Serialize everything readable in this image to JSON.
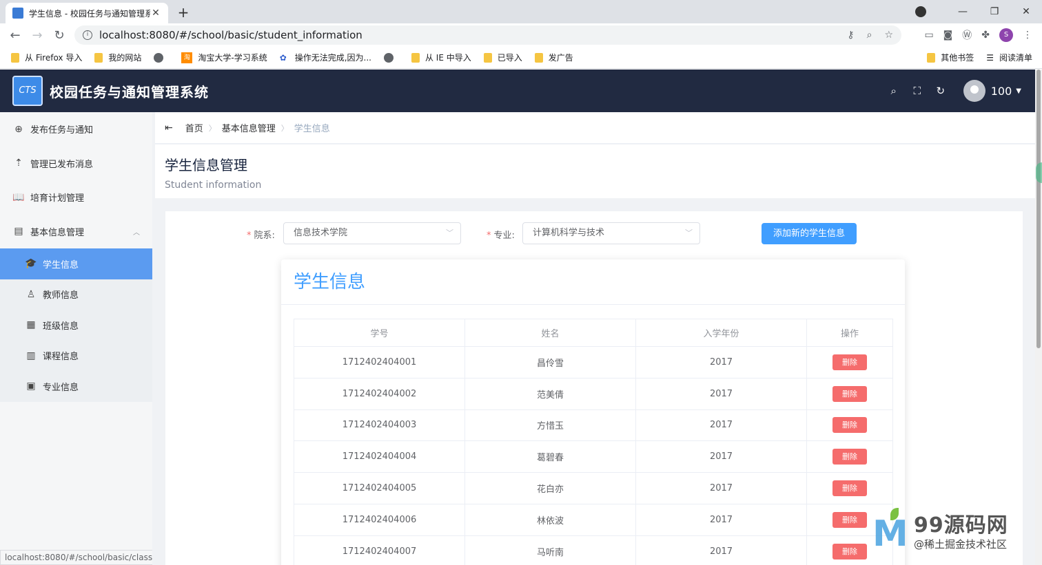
{
  "browser": {
    "tab_title": "学生信息 - 校园任务与通知管理系统",
    "tab_close": "✕",
    "new_tab": "+",
    "url_prefix": "localhost",
    "url": "localhost:8080/#/school/basic/student_information",
    "window_controls": [
      "—",
      "❐",
      "✕"
    ],
    "bookmarks": [
      {
        "label": "从 Firefox 导入",
        "icon": "folder"
      },
      {
        "label": "我的网站",
        "icon": "folder"
      },
      {
        "label": "",
        "icon": "globe"
      },
      {
        "label": "淘宝大学-学习系统",
        "icon": "taobao"
      },
      {
        "label": "操作无法完成,因为...",
        "icon": "paw"
      },
      {
        "label": "",
        "icon": "globe"
      },
      {
        "label": "从 IE 中导入",
        "icon": "folder"
      },
      {
        "label": "已导入",
        "icon": "folder"
      },
      {
        "label": "发广告",
        "icon": "folder"
      }
    ],
    "bookmarks_right": [
      "其他书签",
      "阅读清单"
    ],
    "profile_initial": "S",
    "status_url": "localhost:8080/#/school/basic/class"
  },
  "header": {
    "logo_text": "CTS",
    "app_title": "校园任务与通知管理系统",
    "user_name": "100"
  },
  "sidebar": {
    "items": [
      {
        "label": "发布任务与通知",
        "icon": "plus-circle-icon"
      },
      {
        "label": "管理已发布消息",
        "icon": "upload-icon"
      },
      {
        "label": "培育计划管理",
        "icon": "book-icon"
      },
      {
        "label": "基本信息管理",
        "icon": "document-icon"
      }
    ],
    "sub_items": [
      {
        "label": "学生信息",
        "icon": "graduation-cap-icon",
        "active": true
      },
      {
        "label": "教师信息",
        "icon": "teacher-icon",
        "active": false
      },
      {
        "label": "班级信息",
        "icon": "class-icon",
        "active": false
      },
      {
        "label": "课程信息",
        "icon": "course-icon",
        "active": false
      },
      {
        "label": "专业信息",
        "icon": "major-icon",
        "active": false
      }
    ]
  },
  "breadcrumb": [
    "首页",
    "基本信息管理",
    "学生信息"
  ],
  "page": {
    "title": "学生信息管理",
    "subtitle": "Student information"
  },
  "filters": {
    "college_label": "院系:",
    "college_value": "信息技术学院",
    "major_label": "专业:",
    "major_value": "计算机科学与技术",
    "add_button": "添加新的学生信息"
  },
  "table": {
    "card_title": "学生信息",
    "columns": [
      "学号",
      "姓名",
      "入学年份",
      "操作"
    ],
    "delete_label": "删除",
    "rows": [
      {
        "id": "1712402404001",
        "name": "昌伶雪",
        "year": "2017"
      },
      {
        "id": "1712402404002",
        "name": "范美倩",
        "year": "2017"
      },
      {
        "id": "1712402404003",
        "name": "方惜玉",
        "year": "2017"
      },
      {
        "id": "1712402404004",
        "name": "葛碧春",
        "year": "2017"
      },
      {
        "id": "1712402404005",
        "name": "花白亦",
        "year": "2017"
      },
      {
        "id": "1712402404006",
        "name": "林依波",
        "year": "2017"
      },
      {
        "id": "1712402404007",
        "name": "马听南",
        "year": "2017"
      }
    ]
  },
  "watermark": {
    "main": "99源码网",
    "sub": "@稀土掘金技术社区"
  },
  "colors": {
    "header_bg": "#212a41",
    "accent": "#409eff",
    "active_menu": "#5b9bf0",
    "danger": "#f56c6c"
  }
}
